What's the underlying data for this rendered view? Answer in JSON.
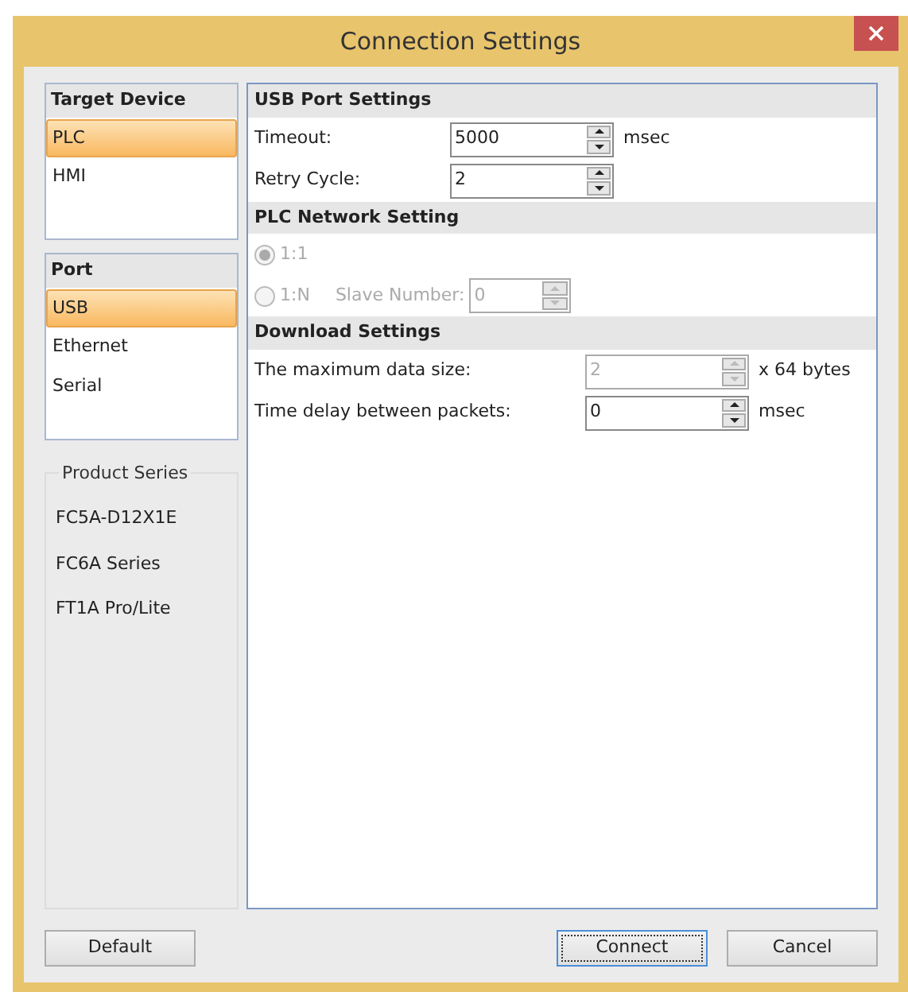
{
  "window": {
    "title": "Connection Settings"
  },
  "target_device": {
    "title": "Target Device",
    "items": [
      {
        "label": "PLC",
        "selected": true
      },
      {
        "label": "HMI",
        "selected": false
      }
    ]
  },
  "port": {
    "title": "Port",
    "items": [
      {
        "label": "USB",
        "selected": true
      },
      {
        "label": "Ethernet",
        "selected": false
      },
      {
        "label": "Serial",
        "selected": false
      }
    ]
  },
  "product_series": {
    "title": "Product Series",
    "items": [
      "FC5A-D12X1E",
      "FC6A Series",
      "FT1A Pro/Lite"
    ]
  },
  "sections": [
    {
      "title": "USB Port Settings",
      "rows": [
        {
          "kind": "spin",
          "label": "Timeout:",
          "value": "5000",
          "unit": "msec",
          "disabled": false
        },
        {
          "kind": "spin",
          "label": "Retry Cycle:",
          "value": "2",
          "disabled": false
        }
      ]
    },
    {
      "title": "PLC Network Setting",
      "rows": [
        {
          "kind": "radio",
          "label": "1:1",
          "selected": true,
          "disabled": true
        },
        {
          "kind": "radio",
          "label": "1:N",
          "selected": false,
          "disabled": true,
          "field_label": "Slave Number:",
          "value": "0"
        }
      ]
    },
    {
      "title": "Download Settings",
      "rows": [
        {
          "kind": "spin",
          "label": "The maximum data size:",
          "value": "2",
          "unit": "x 64 bytes",
          "disabled": true
        },
        {
          "kind": "spin",
          "label": "Time delay between packets:",
          "value": "0",
          "unit": "msec",
          "disabled": false
        }
      ]
    }
  ],
  "buttons": [
    {
      "label": "Default",
      "focused": false
    },
    {
      "label": "Connect",
      "focused": true
    },
    {
      "label": "Cancel",
      "focused": false
    }
  ]
}
